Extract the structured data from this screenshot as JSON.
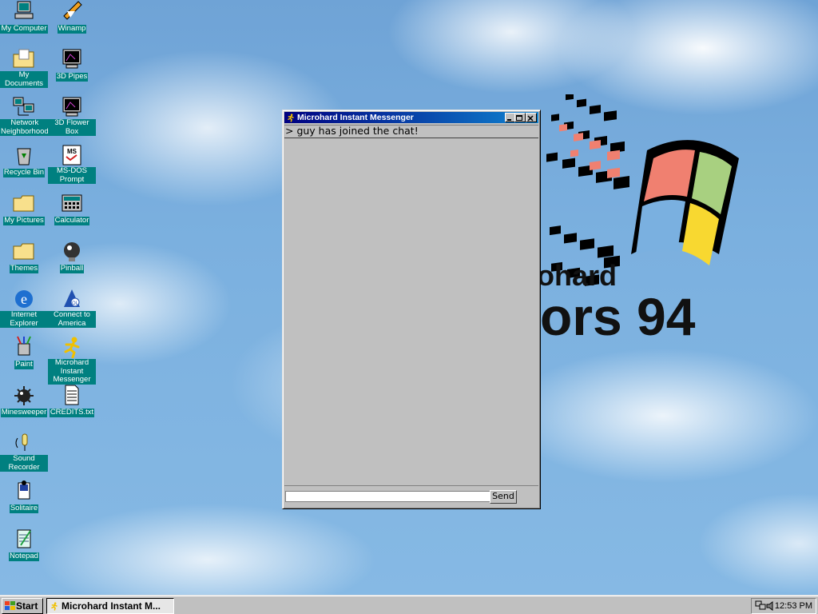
{
  "desktop": {
    "icons": [
      {
        "name": "my-computer",
        "label": "My Computer",
        "icon": "computer-icon"
      },
      {
        "name": "winamp",
        "label": "Winamp",
        "icon": "winamp-icon"
      },
      {
        "name": "my-documents",
        "label": "My Documents",
        "icon": "folder-documents-icon"
      },
      {
        "name": "3d-pipes",
        "label": "3D Pipes",
        "icon": "screensaver-icon"
      },
      {
        "name": "network-neighborhood",
        "label": "Network Neighborhood",
        "icon": "network-icon"
      },
      {
        "name": "3d-flower-box",
        "label": "3D Flower Box",
        "icon": "screensaver-icon"
      },
      {
        "name": "recycle-bin",
        "label": "Recycle Bin",
        "icon": "recycle-bin-icon"
      },
      {
        "name": "ms-dos-prompt",
        "label": "MS-DOS Prompt",
        "icon": "msdos-icon"
      },
      {
        "name": "my-pictures",
        "label": "My Pictures",
        "icon": "folder-icon"
      },
      {
        "name": "calculator",
        "label": "Calculator",
        "icon": "calculator-icon"
      },
      {
        "name": "themes",
        "label": "Themes",
        "icon": "folder-icon"
      },
      {
        "name": "pinball",
        "label": "Pinball",
        "icon": "pinball-icon"
      },
      {
        "name": "internet-explorer",
        "label": "Internet Explorer",
        "icon": "internet-explorer-icon"
      },
      {
        "name": "connect-to-america",
        "label": "Connect to America",
        "icon": "aol-icon"
      },
      {
        "name": "paint",
        "label": "Paint",
        "icon": "paint-icon"
      },
      {
        "name": "microhard-instant-messenger",
        "label": "Microhard Instant Messenger",
        "icon": "messenger-running-man-icon"
      },
      {
        "name": "minesweeper",
        "label": "Minesweeper",
        "icon": "minesweeper-icon"
      },
      {
        "name": "credits-txt",
        "label": "CREDITS.txt",
        "icon": "text-file-icon"
      },
      {
        "name": "sound-recorder",
        "label": "Sound Recorder",
        "icon": "sound-recorder-icon"
      },
      {
        "name": "solitaire",
        "label": "Solitaire",
        "icon": "solitaire-icon"
      },
      {
        "name": "notepad",
        "label": "Notepad",
        "icon": "notepad-icon"
      }
    ],
    "wallpaper_logo": {
      "line1": "ohard",
      "line2": "ors 94",
      "colors": {
        "red": "#f08070",
        "green": "#a8d080",
        "blue": "#7ab0e0",
        "yellow": "#f8d830",
        "frame": "#000000"
      }
    }
  },
  "window": {
    "title": "Microhard Instant Messenger",
    "chat_lines": [
      "> guy has joined the chat!"
    ],
    "input_value": "",
    "send_label": "Send"
  },
  "taskbar": {
    "start_label": "Start",
    "tasks": [
      "Microhard Instant M..."
    ],
    "clock": "12:53 PM"
  },
  "colors": {
    "titlebar_start": "#000080",
    "titlebar_end": "#1084d0",
    "face": "#c0c0c0",
    "icon_label_bg": "#008080"
  }
}
